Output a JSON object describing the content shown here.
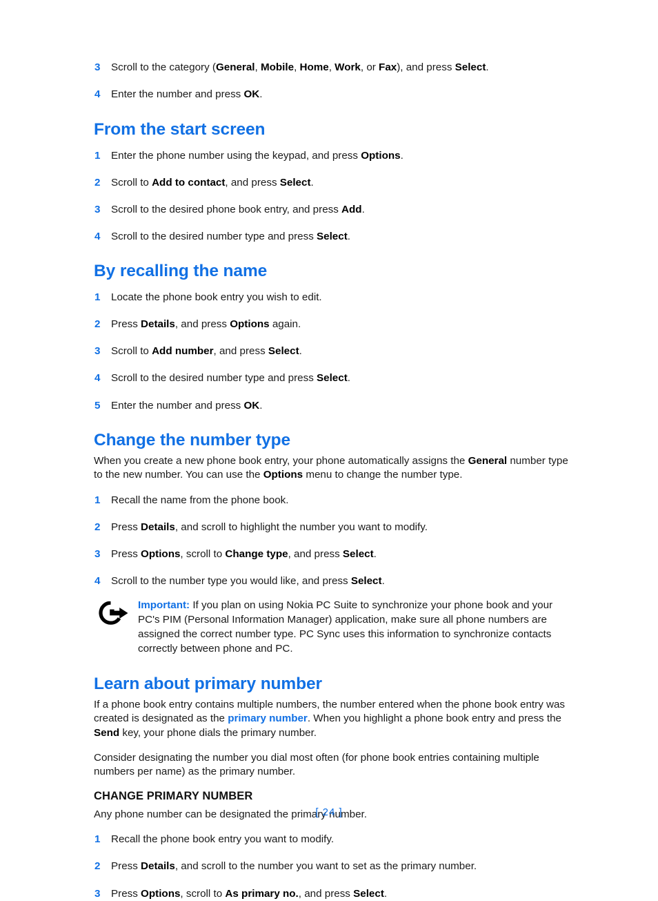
{
  "document": {
    "page_number": "[ 24 ]",
    "accent_color": "#1170e4",
    "text_color": "#1a1a1a"
  },
  "top_steps": [
    {
      "num": "3",
      "parts": [
        {
          "t": "Scroll to the category (",
          "s": "n"
        },
        {
          "t": "General",
          "s": "b"
        },
        {
          "t": ", ",
          "s": "n"
        },
        {
          "t": "Mobile",
          "s": "b"
        },
        {
          "t": ", ",
          "s": "n"
        },
        {
          "t": "Home",
          "s": "b"
        },
        {
          "t": ", ",
          "s": "n"
        },
        {
          "t": "Work",
          "s": "b"
        },
        {
          "t": ", or ",
          "s": "n"
        },
        {
          "t": "Fax",
          "s": "b"
        },
        {
          "t": "), and press ",
          "s": "n"
        },
        {
          "t": "Select",
          "s": "b"
        },
        {
          "t": ".",
          "s": "n"
        }
      ]
    },
    {
      "num": "4",
      "parts": [
        {
          "t": "Enter the number and press ",
          "s": "n"
        },
        {
          "t": "OK",
          "s": "b"
        },
        {
          "t": ".",
          "s": "n"
        }
      ]
    }
  ],
  "section_start_screen": {
    "heading": "From the start screen",
    "steps": [
      {
        "num": "1",
        "parts": [
          {
            "t": "Enter the phone number using the keypad, and press ",
            "s": "n"
          },
          {
            "t": "Options",
            "s": "b"
          },
          {
            "t": ".",
            "s": "n"
          }
        ]
      },
      {
        "num": "2",
        "parts": [
          {
            "t": "Scroll to ",
            "s": "n"
          },
          {
            "t": "Add to contact",
            "s": "b"
          },
          {
            "t": ", and press ",
            "s": "n"
          },
          {
            "t": "Select",
            "s": "b"
          },
          {
            "t": ".",
            "s": "n"
          }
        ]
      },
      {
        "num": "3",
        "parts": [
          {
            "t": "Scroll to the desired phone book entry, and press ",
            "s": "n"
          },
          {
            "t": "Add",
            "s": "b"
          },
          {
            "t": ".",
            "s": "n"
          }
        ]
      },
      {
        "num": "4",
        "parts": [
          {
            "t": "Scroll to the desired number type and press ",
            "s": "n"
          },
          {
            "t": "Select",
            "s": "b"
          },
          {
            "t": ".",
            "s": "n"
          }
        ]
      }
    ]
  },
  "section_recalling_name": {
    "heading": "By recalling the name",
    "steps": [
      {
        "num": "1",
        "parts": [
          {
            "t": "Locate the phone book entry you wish to edit.",
            "s": "n"
          }
        ]
      },
      {
        "num": "2",
        "parts": [
          {
            "t": "Press ",
            "s": "n"
          },
          {
            "t": "Details",
            "s": "b"
          },
          {
            "t": ", and press ",
            "s": "n"
          },
          {
            "t": "Options",
            "s": "b"
          },
          {
            "t": " again.",
            "s": "n"
          }
        ]
      },
      {
        "num": "3",
        "parts": [
          {
            "t": "Scroll to ",
            "s": "n"
          },
          {
            "t": "Add number",
            "s": "b"
          },
          {
            "t": ", and press ",
            "s": "n"
          },
          {
            "t": "Select",
            "s": "b"
          },
          {
            "t": ".",
            "s": "n"
          }
        ]
      },
      {
        "num": "4",
        "parts": [
          {
            "t": "Scroll to the desired number type and press ",
            "s": "n"
          },
          {
            "t": "Select",
            "s": "b"
          },
          {
            "t": ".",
            "s": "n"
          }
        ]
      },
      {
        "num": "5",
        "parts": [
          {
            "t": "Enter the number and press ",
            "s": "n"
          },
          {
            "t": "OK",
            "s": "b"
          },
          {
            "t": ".",
            "s": "n"
          }
        ]
      }
    ]
  },
  "section_change_number_type": {
    "heading": "Change the number type",
    "intro": [
      {
        "t": "When you create a new phone book entry, your phone automatically assigns the ",
        "s": "n"
      },
      {
        "t": "General",
        "s": "b"
      },
      {
        "t": " number type to the new number. You can use the ",
        "s": "n"
      },
      {
        "t": "Options",
        "s": "b"
      },
      {
        "t": " menu to change the number type.",
        "s": "n"
      }
    ],
    "steps": [
      {
        "num": "1",
        "parts": [
          {
            "t": "Recall the name from the phone book.",
            "s": "n"
          }
        ]
      },
      {
        "num": "2",
        "parts": [
          {
            "t": "Press ",
            "s": "n"
          },
          {
            "t": "Details",
            "s": "b"
          },
          {
            "t": ", and scroll to highlight the number you want to modify.",
            "s": "n"
          }
        ]
      },
      {
        "num": "3",
        "parts": [
          {
            "t": "Press ",
            "s": "n"
          },
          {
            "t": "Options",
            "s": "b"
          },
          {
            "t": ", scroll to ",
            "s": "n"
          },
          {
            "t": "Change type",
            "s": "b"
          },
          {
            "t": ", and press ",
            "s": "n"
          },
          {
            "t": "Select",
            "s": "b"
          },
          {
            "t": ".",
            "s": "n"
          }
        ]
      },
      {
        "num": "4",
        "parts": [
          {
            "t": "Scroll to the number type you would like, and press ",
            "s": "n"
          },
          {
            "t": "Select",
            "s": "b"
          },
          {
            "t": ".",
            "s": "n"
          }
        ]
      }
    ],
    "note": {
      "icon": "important-arrow-icon",
      "label": "Important:",
      "parts": [
        {
          "t": " If you plan on using Nokia PC Suite to synchronize your phone book and your PC's PIM (Personal Information Manager) application, make sure all phone numbers are assigned the correct number type. PC Sync uses this information to synchronize contacts correctly between phone and PC.",
          "s": "n"
        }
      ]
    }
  },
  "section_primary_number": {
    "heading": "Learn about primary number",
    "paragraph1": [
      {
        "t": "If a phone book entry contains multiple numbers, the number entered when the phone book entry was created is designated as the ",
        "s": "n"
      },
      {
        "t": "primary number",
        "s": "bb"
      },
      {
        "t": ". When you highlight a phone book entry and press the ",
        "s": "n"
      },
      {
        "t": "Send",
        "s": "b"
      },
      {
        "t": " key, your phone dials the primary number.",
        "s": "n"
      }
    ],
    "paragraph2": [
      {
        "t": "Consider designating the number you dial most often (for phone book entries containing multiple numbers per name) as the primary number.",
        "s": "n"
      }
    ],
    "subheading": "CHANGE PRIMARY NUMBER",
    "paragraph3": [
      {
        "t": "Any phone number can be designated the primary number.",
        "s": "n"
      }
    ],
    "steps": [
      {
        "num": "1",
        "parts": [
          {
            "t": "Recall the phone book entry you want to modify.",
            "s": "n"
          }
        ]
      },
      {
        "num": "2",
        "parts": [
          {
            "t": "Press ",
            "s": "n"
          },
          {
            "t": "Details",
            "s": "b"
          },
          {
            "t": ", and scroll to the number you want to set as the primary number.",
            "s": "n"
          }
        ]
      },
      {
        "num": "3",
        "parts": [
          {
            "t": "Press ",
            "s": "n"
          },
          {
            "t": "Options",
            "s": "b"
          },
          {
            "t": ", scroll to ",
            "s": "n"
          },
          {
            "t": "As primary no.",
            "s": "b"
          },
          {
            "t": ", and press ",
            "s": "n"
          },
          {
            "t": "Select",
            "s": "b"
          },
          {
            "t": ".",
            "s": "n"
          }
        ]
      }
    ]
  }
}
